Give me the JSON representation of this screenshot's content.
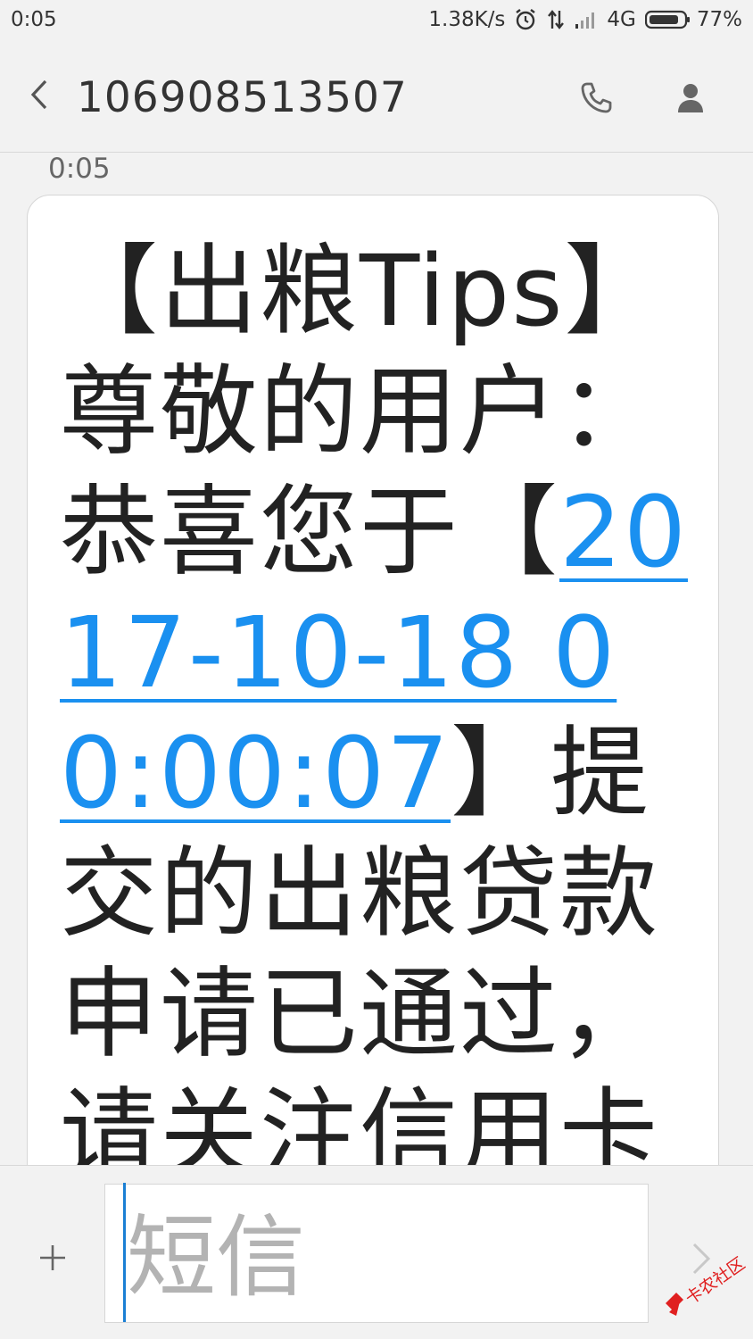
{
  "status_bar": {
    "time": "0:05",
    "network_speed": "1.38K/s",
    "network_type": "4G",
    "battery": "77%",
    "icons": [
      "alarm-icon",
      "data-transfer-icon",
      "signal-icon",
      "battery-icon"
    ]
  },
  "header": {
    "contact": "106908513507",
    "icons": [
      "back-chevron-icon",
      "phone-icon",
      "person-icon"
    ]
  },
  "conversation": {
    "time": "0:05",
    "message_before_link": "【出粮Tips】尊敬的用户：恭喜您于【",
    "message_link": "2017-10-18 00:00:07",
    "message_after_link": "】提交的出粮贷款申请已通过，请关注信用卡"
  },
  "compose": {
    "placeholder": "短信",
    "icons": [
      "plus-icon",
      "send-chevron-icon"
    ]
  },
  "watermark": {
    "text": "卡农社区"
  },
  "colors": {
    "background": "#f2f2f2",
    "link": "#1a90f0",
    "caret": "#1a7fd4",
    "watermark": "#e02020"
  }
}
